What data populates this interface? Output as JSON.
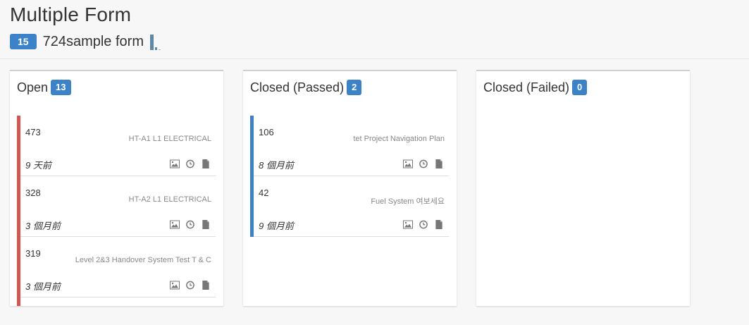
{
  "page": {
    "title": "Multiple Form"
  },
  "form": {
    "count": "15",
    "name": "724sample form"
  },
  "columns": [
    {
      "title": "Open",
      "count": "13",
      "cards": [
        {
          "number": "473",
          "description": "HT-A1 L1 ELECTRICAL",
          "time": "9 天前"
        },
        {
          "number": "328",
          "description": "HT-A2 L1 ELECTRICAL",
          "time": "3 個月前"
        },
        {
          "number": "319",
          "description": "Level 2&3 Handover System Test T & C",
          "time": "3 個月前"
        }
      ]
    },
    {
      "title": "Closed (Passed)",
      "count": "2",
      "cards": [
        {
          "number": "106",
          "description": "tet Project Navigation Plan",
          "time": "8 個月前"
        },
        {
          "number": "42",
          "description": "Fuel System 여보세요",
          "time": "9 個月前"
        }
      ]
    },
    {
      "title": "Closed (Failed)",
      "count": "0",
      "cards": []
    }
  ],
  "colors": {
    "badge": "#3b82c8",
    "open": "#d9534f",
    "passed": "#3b82c8"
  },
  "icons": [
    "image-icon",
    "clock-icon",
    "document-icon"
  ]
}
